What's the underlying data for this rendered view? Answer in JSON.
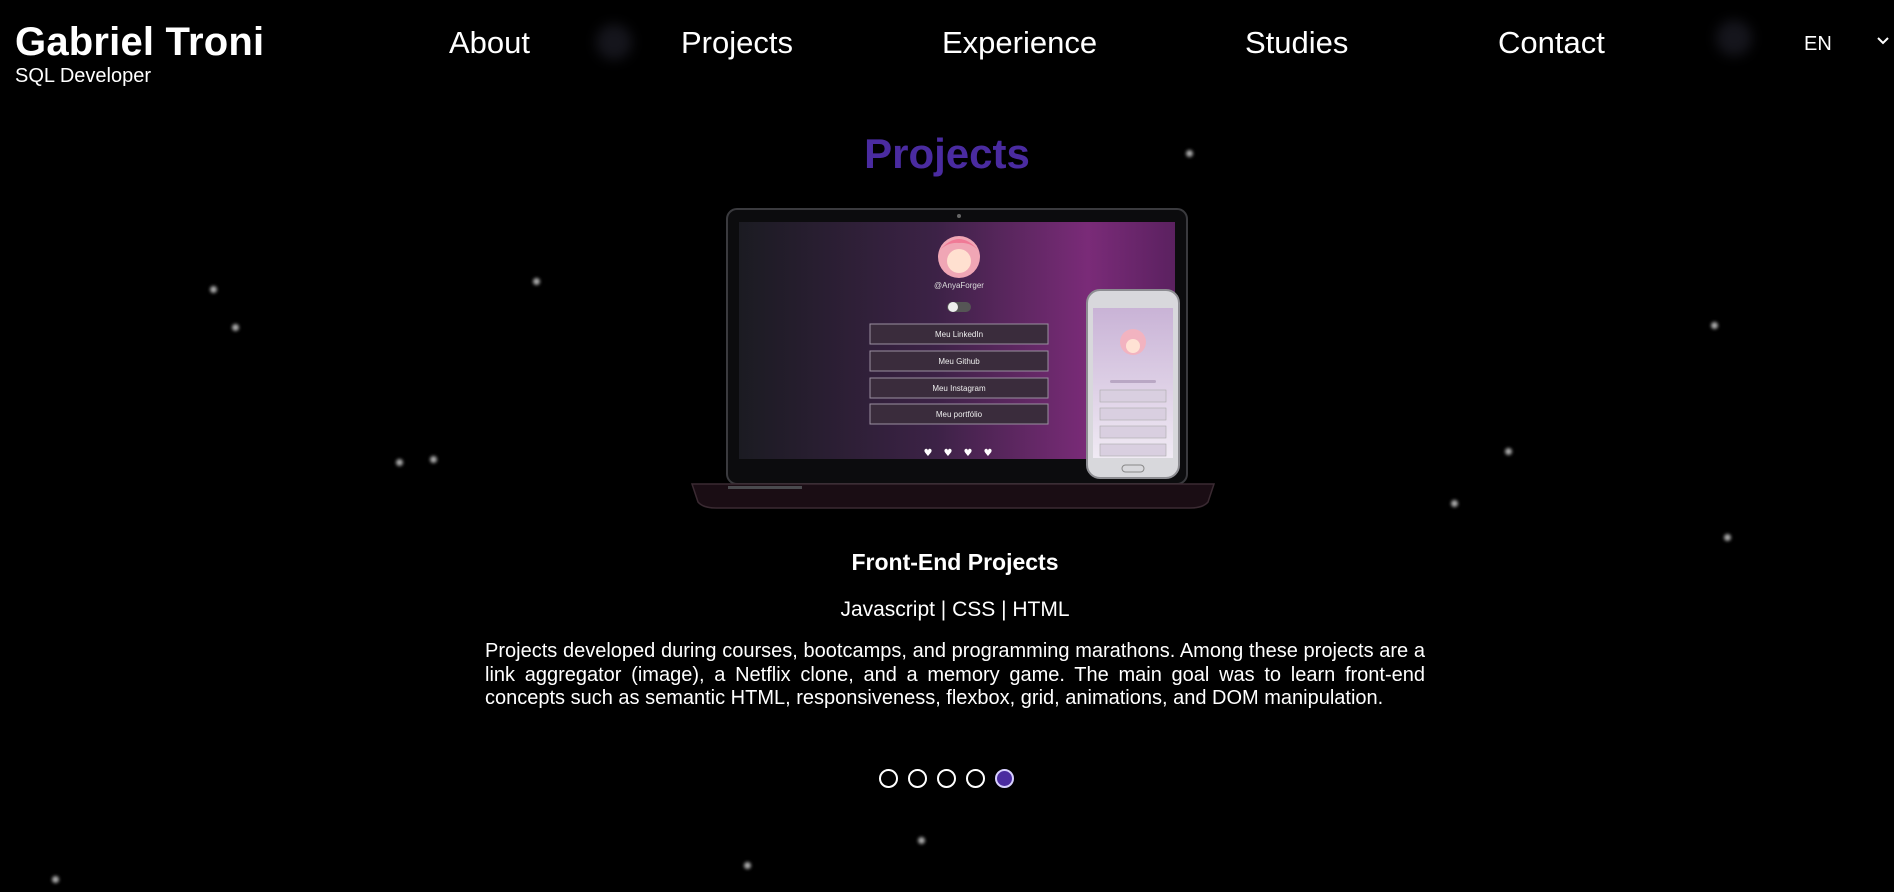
{
  "brand": {
    "name": "Gabriel Troni",
    "role": "SQL Developer"
  },
  "nav": {
    "about": "About",
    "projects": "Projects",
    "experience": "Experience",
    "studies": "Studies",
    "contact": "Contact"
  },
  "language": {
    "selected": "EN"
  },
  "section": {
    "title": "Projects"
  },
  "project": {
    "title": "Front-End Projects",
    "tech": "Javascript | CSS | HTML",
    "description": "Projects developed during courses, bootcamps, and programming marathons. Among these projects are a link aggregator (image), a Netflix clone, and a memory game. The main goal was to learn front-end concepts such as semantic HTML, responsiveness, flexbox, grid, animations, and DOM manipulation.",
    "image": {
      "handle": "@AnyaForger",
      "links": [
        "Meu LinkedIn",
        "Meu Github",
        "Meu Instagram",
        "Meu portfólio"
      ]
    }
  },
  "carousel": {
    "total": 5,
    "active": 5
  },
  "colors": {
    "accent": "#4a2ba0",
    "background": "#000000",
    "text": "#ffffff"
  },
  "icons": {
    "language_chevron": "chevron-down-icon"
  }
}
